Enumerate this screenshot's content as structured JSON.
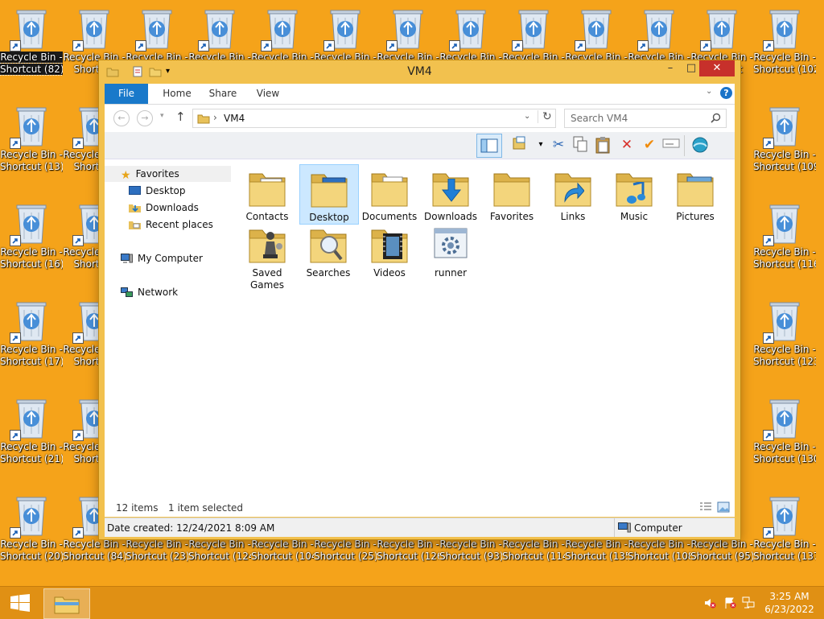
{
  "desktop": {
    "icons": [
      {
        "label": "Recycle Bin - Shortcut (82)",
        "selected": true
      },
      {
        "label": "Recycle Bin - Shortcut (102)"
      },
      {
        "label": "Recycle Bin - Shortcut (13)"
      },
      {
        "label": "Recycle Bin - Shortcut (109)"
      },
      {
        "label": "Recycle Bin - Shortcut (16)"
      },
      {
        "label": "Recycle Bin - Shortcut (116)"
      },
      {
        "label": "Recycle Bin - Shortcut (17)"
      },
      {
        "label": "Recycle Bin - Shortcut (123)"
      },
      {
        "label": "Recycle Bin - Shortcut (21)"
      },
      {
        "label": "Recycle Bin - Shortcut (130)"
      },
      {
        "label": "Recycle Bin - Shortcut (20)"
      },
      {
        "label": "Recycle Bin - Shortcut (84)"
      },
      {
        "label": "Recycle Bin - Shortcut (23)"
      },
      {
        "label": "Recycle Bin - Shortcut (124)"
      },
      {
        "label": "Recycle Bin - Shortcut (104)"
      },
      {
        "label": "Recycle Bin - Shortcut (25)"
      },
      {
        "label": "Recycle Bin - Shortcut (126)"
      },
      {
        "label": "Recycle Bin - Shortcut (93)"
      },
      {
        "label": "Recycle Bin - Shortcut (114)"
      },
      {
        "label": "Recycle Bin - Shortcut (135)"
      },
      {
        "label": "Recycle Bin - Shortcut (108)"
      },
      {
        "label": "Recycle Bin - Shortcut (95)"
      },
      {
        "label": "Recycle Bin - Shortcut (137)"
      },
      {
        "label": "Recycle Bin -"
      },
      {
        "label": "Shortcut"
      }
    ]
  },
  "window": {
    "title": "VM4",
    "controls": {
      "minimize": "–",
      "maximize": "□",
      "close": "✕"
    },
    "ribbon_tabs": [
      "File",
      "Home",
      "Share",
      "View"
    ],
    "address": {
      "path": "VM4",
      "separator": "›"
    },
    "search": {
      "placeholder": "Search VM4"
    },
    "nav": {
      "favorites": "Favorites",
      "favorites_items": [
        "Desktop",
        "Downloads",
        "Recent places"
      ],
      "computer": "My Computer",
      "network": "Network"
    },
    "items": [
      {
        "name": "Contacts",
        "icon": "contacts-folder-icon"
      },
      {
        "name": "Desktop",
        "icon": "desktop-folder-icon",
        "selected": true
      },
      {
        "name": "Documents",
        "icon": "documents-folder-icon"
      },
      {
        "name": "Downloads",
        "icon": "downloads-folder-icon"
      },
      {
        "name": "Favorites",
        "icon": "favorites-folder-icon"
      },
      {
        "name": "Links",
        "icon": "links-folder-icon"
      },
      {
        "name": "Music",
        "icon": "music-folder-icon"
      },
      {
        "name": "Pictures",
        "icon": "pictures-folder-icon"
      },
      {
        "name": "Saved Games",
        "icon": "saved-games-folder-icon"
      },
      {
        "name": "Searches",
        "icon": "searches-folder-icon"
      },
      {
        "name": "Videos",
        "icon": "videos-folder-icon"
      },
      {
        "name": "runner",
        "icon": "runner-file-icon"
      }
    ],
    "status": {
      "count": "12 items",
      "selection": "1 item selected"
    },
    "details": {
      "date_created": "Date created: 12/24/2021 8:09 AM",
      "location": "Computer"
    }
  },
  "taskbar": {
    "time": "3:25 AM",
    "date": "6/23/2022"
  },
  "colors": {
    "desktop": "#f5a31a",
    "accent": "#1979ca",
    "close": "#c7302b",
    "selection": "#cce8ff"
  }
}
